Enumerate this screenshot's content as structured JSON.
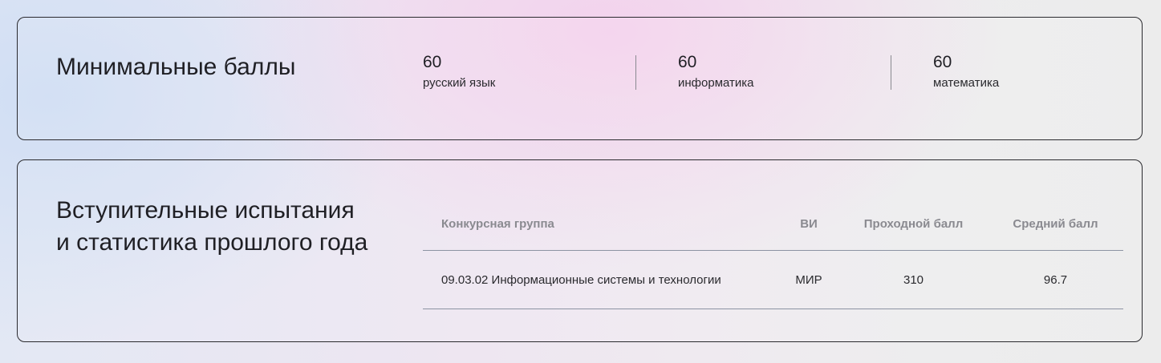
{
  "minimal_scores": {
    "title": "Минимальные баллы",
    "items": [
      {
        "value": "60",
        "subject": "русский язык"
      },
      {
        "value": "60",
        "subject": "информатика"
      },
      {
        "value": "60",
        "subject": "математика"
      }
    ]
  },
  "entrance_exams": {
    "title_lines": [
      "Вступительные испытания",
      "и статистика прошлого года"
    ],
    "table": {
      "headers": [
        "Конкурсная группа",
        "ВИ",
        "Проходной балл",
        "Средний балл"
      ],
      "rows": [
        [
          "09.03.02 Информационные системы и технологии",
          "МИР",
          "310",
          "96.7"
        ]
      ]
    }
  },
  "colors": {
    "border": "#2a2a2e",
    "header_text": "#8a8a90",
    "divider": "#8c93a3"
  }
}
